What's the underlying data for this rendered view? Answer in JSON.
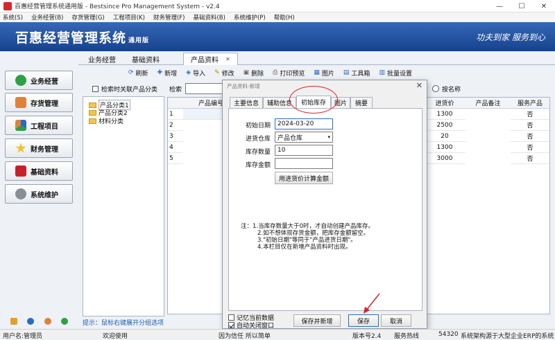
{
  "window": {
    "title": "百惠经营管理系统通用版 - Bestsince Pro Management System - v2.4"
  },
  "menu": [
    "系统(S)",
    "业务经营(B)",
    "存货管理(G)",
    "工程项目(K)",
    "财务管理(F)",
    "基础资料(B)",
    "系统维护(P)",
    "帮助(H)"
  ],
  "banner": {
    "brand": "百惠经营管理系统",
    "edition": "通用版",
    "slogan": "功夫到家  服务到心"
  },
  "nav": [
    "业务经营",
    "存货管理",
    "工程项目",
    "财务管理",
    "基础资料",
    "系统维护"
  ],
  "tabs": [
    "业务经营",
    "基础资料",
    "产品资料"
  ],
  "toolbar": [
    "刷新",
    "新增",
    "导入",
    "修改",
    "删除",
    "打印预览",
    "图片",
    "工具箱",
    "批量设置"
  ],
  "category": {
    "search_related": "检索时关联产品分类",
    "items": [
      "产品分类1",
      "产品分类2",
      "材料分类"
    ],
    "hint": "提示：鼠标右键展开分组选项"
  },
  "search": {
    "label": "检索",
    "sort": "按名称"
  },
  "grid": {
    "columns": [
      "产品编号",
      "进货价",
      "产品备注",
      "服务产品"
    ],
    "rows": [
      {
        "n": "1",
        "price": "1300",
        "svc": "否"
      },
      {
        "n": "2",
        "price": "2500",
        "svc": "否"
      },
      {
        "n": "3",
        "price": "20",
        "svc": "否"
      },
      {
        "n": "4",
        "price": "1300",
        "svc": "否"
      },
      {
        "n": "5",
        "price": "3000",
        "svc": "否"
      }
    ]
  },
  "dialog": {
    "title": "产品资料-新增",
    "tabs": [
      "主要信息",
      "辅助信息",
      "初始库存",
      "图片",
      "摘要"
    ],
    "fields": {
      "date_label": "初始日期",
      "date_value": "2024-03-20",
      "warehouse_label": "进货仓库",
      "warehouse_value": "产品仓库",
      "qty_label": "库存数量",
      "qty_value": "10",
      "amount_label": "库存金额",
      "amount_value": ""
    },
    "calc_button": "用进货价计算金额",
    "notes": [
      "注：1.当库存数量大于0时，才自动创建产品库存。",
      "2.如不想体现存货金额，把库存金额留空。",
      "3.\"初始日期\"等同于\"产品进货日期\"。",
      "4.本栏目仅在新增产品资料时出现。"
    ],
    "remember": "记忆当前数据",
    "autoclose": "自动关闭窗口",
    "buttons": {
      "save_new": "保存并新增",
      "save": "保存",
      "cancel": "取消"
    }
  },
  "status": {
    "user": "用户名:管理员",
    "welcome": "欢迎使用",
    "motto": "因为信任 所以简单",
    "version": "版本号2.4",
    "service_label": "服务热线",
    "service_no": "54320",
    "arch": "系统架构源于大型企业ERP的系统"
  },
  "icons": [
    "check-icon",
    "house-icon",
    "recycle-icon",
    "star-icon",
    "book-icon",
    "gear-icon"
  ],
  "colors": {
    "banner": "#1f4c9c",
    "accent": "#d9232d"
  }
}
